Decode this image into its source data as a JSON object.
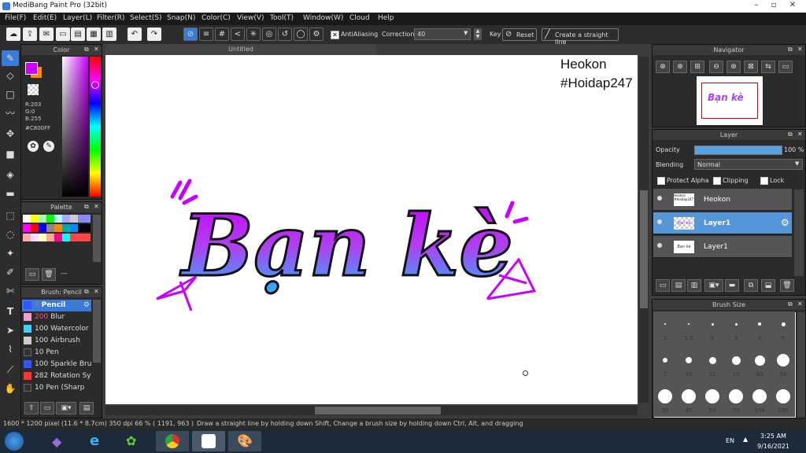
{
  "app": {
    "title": "MediBang Paint Pro (32bit)"
  },
  "menu": [
    "File(F)",
    "Edit(E)",
    "Layer(L)",
    "Filter(R)",
    "Select(S)",
    "Snap(N)",
    "Color(C)",
    "View(V)",
    "Tool(T)",
    "Window(W)",
    "Cloud",
    "Help"
  ],
  "toolbar": {
    "antialiasing_label": "AntiAliasing",
    "correction_label": "Correction",
    "correction_value": "40",
    "key_label": "Key",
    "reset_label": "Reset",
    "straight_line_label": "Create a straight line"
  },
  "canvas": {
    "tab_title": "Untitled",
    "text_line1": "Heokon",
    "text_line2": "#Hoidap247",
    "art_text": "Bạn kè"
  },
  "color_panel": {
    "title": "Color",
    "r": "R:203",
    "g": "G:0",
    "b": "B:255",
    "hex": "#C800FF",
    "fg_color": "#C800FF",
    "bg_color": "#FF8C00"
  },
  "palette_panel": {
    "title": "Palette",
    "footer_text": "---"
  },
  "brush_panel": {
    "title": "Brush: Pencil",
    "items": [
      {
        "size": "7",
        "name": "Pencil",
        "color": "#3355ff",
        "active": true
      },
      {
        "size": "200",
        "name": "Blur",
        "color": "#f0a0d0"
      },
      {
        "size": "100",
        "name": "Watercolor",
        "color": "#40d0ff"
      },
      {
        "size": "100",
        "name": "Airbrush",
        "color": "#cccccc"
      },
      {
        "size": "10",
        "name": "Pen",
        "color": "#333333"
      },
      {
        "size": "100",
        "name": "Sparkle Bru",
        "color": "#3355ff"
      },
      {
        "size": "282",
        "name": "Rotation Sy",
        "color": "#ff3333"
      },
      {
        "size": "10",
        "name": "Pen (Sharp",
        "color": "#333333"
      }
    ]
  },
  "navigator": {
    "title": "Navigator"
  },
  "layer_panel": {
    "title": "Layer",
    "opacity_label": "Opacity",
    "opacity_value": "100 %",
    "blending_label": "Blending",
    "blending_value": "Normal",
    "protect_alpha_label": "Protect Alpha",
    "clipping_label": "Clipping",
    "lock_label": "Lock",
    "layers": [
      {
        "name": "Heokon",
        "thumb_text": "Heokon #Hoidap247",
        "active": false
      },
      {
        "name": "Layer1",
        "thumb_text": "Bạn kè",
        "active": true
      },
      {
        "name": "Layer1",
        "thumb_text": "Bạn kè",
        "active": false
      }
    ]
  },
  "brush_size_panel": {
    "title": "Brush Size",
    "sizes": [
      "1",
      "1.5",
      "2",
      "3",
      "4",
      "5",
      "7",
      "10",
      "12",
      "15",
      "20",
      "25",
      "30",
      "40",
      "50",
      "70",
      "100",
      "150"
    ]
  },
  "status": {
    "dims": "1600 * 1200 pixel  (11.6 * 8.7cm)  350 dpi  66 %  ( 1191, 963 )",
    "hint": "Draw a straight line by holding down Shift, Change a brush size by holding down Ctrl, Alt, and dragging"
  },
  "taskbar": {
    "lang": "EN",
    "time": "3:25 AM",
    "date": "9/16/2021"
  }
}
